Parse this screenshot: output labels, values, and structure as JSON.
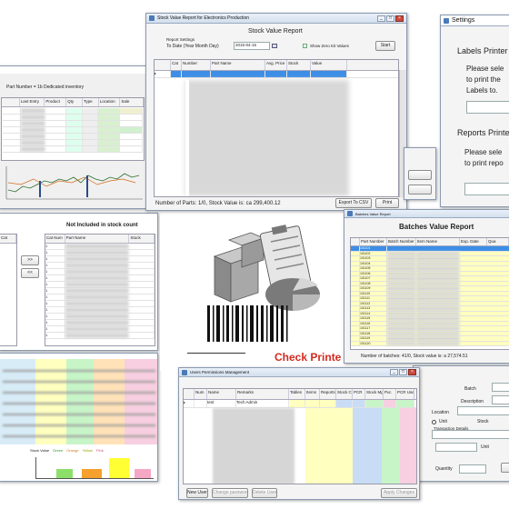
{
  "colors": {
    "accent": "#1e6fd9",
    "selection": "#3c8ee6",
    "alert_red": "#d42a1f",
    "row_yellow": "#ffffbf",
    "row_green": "#c8f5c8",
    "row_pink": "#f7cfe0"
  },
  "chart_window": {
    "title": "Part Number = 1b Dedicated inventory",
    "columns": [
      "",
      "Last Entry",
      "Product",
      "Qty",
      "Type",
      "Location",
      "Sale"
    ]
  },
  "stock_window": {
    "title": "Stock Value Report for Electronics Production",
    "heading": "Stock Value Report",
    "report_settings_label": "Report Settings",
    "date_label": "To Date (Year Month Day)",
    "date_value": "2015-04-15",
    "show_zero_label": "Show Zero Kit Values",
    "start_button": "Start",
    "columns": [
      "Cat",
      "Number",
      "Part Name",
      "Avg. Price",
      "Stock",
      "Value"
    ],
    "footer": "Number of Parts: 1/0, Stock Value is: ca 299,400.12",
    "export_button": "Export To CSV",
    "print_button": "Print"
  },
  "settings_window": {
    "title": "Settings",
    "labels_heading": "Labels Printer",
    "labels_text": [
      "Please sele",
      "to print the",
      "Labels to."
    ],
    "reports_heading": "Reports Printe",
    "reports_text": [
      "Please sele",
      "to print repo"
    ]
  },
  "not_included_window": {
    "heading": "Not Included in stock count",
    "columns_left": [
      "Cat",
      "Part Name"
    ],
    "columns_right": [
      "Cat Num",
      "Part Name",
      "Stock"
    ],
    "rows": [
      "1",
      "1",
      "1",
      "1",
      "1",
      "1",
      "1",
      "1",
      "1",
      "1",
      "1",
      "1",
      "1",
      "1",
      "1"
    ]
  },
  "splash": {
    "check_text": "Check Printe"
  },
  "batches_window": {
    "title": "Batches Value Report",
    "heading": "Batches Value Report",
    "columns": [
      "Part Number",
      "Batch Number",
      "Item Name",
      "Exp. Date",
      "Qua"
    ],
    "numbers": [
      "101101",
      "101102",
      "101103",
      "101104",
      "101105",
      "101106",
      "101107",
      "101108",
      "101109",
      "101110",
      "101111",
      "101112",
      "101113",
      "101114",
      "101115",
      "101116",
      "101117",
      "101118",
      "101119",
      "101120"
    ],
    "footer": "Number of batches: 41/0, Stock value is: a 27,574.51"
  },
  "form_panel": {
    "batch_label": "Batch",
    "description_label": "Description",
    "location_label": "Location",
    "unit_label": "Unit",
    "stock_label": "Stock",
    "transaction_label": "Transaction Details",
    "quantity_label": "Quantity",
    "unit_value": "Unit"
  },
  "users_window": {
    "title": "Users Permissions Management",
    "columns": [
      "Num",
      "Name",
      "Remarks",
      "Tables",
      "Items",
      "Reports",
      "Stock Count",
      "PCR",
      "Stock Mgmt",
      "Pur.",
      "PCR User"
    ],
    "first_user_name": "test",
    "first_user_remarks": "Tech Admin",
    "new_user_button": "New User",
    "change_password_button": "Change password",
    "delete_button": "Delete User",
    "apply_button": "Apply Changes"
  },
  "colorful_window": {
    "legend": [
      "Stock Value",
      "Green",
      "Orange",
      "Yellow",
      "Pink"
    ],
    "bar_colors": [
      "#8ce06a",
      "#f6a02e",
      "#ffff33",
      "#f5a8c6"
    ]
  }
}
